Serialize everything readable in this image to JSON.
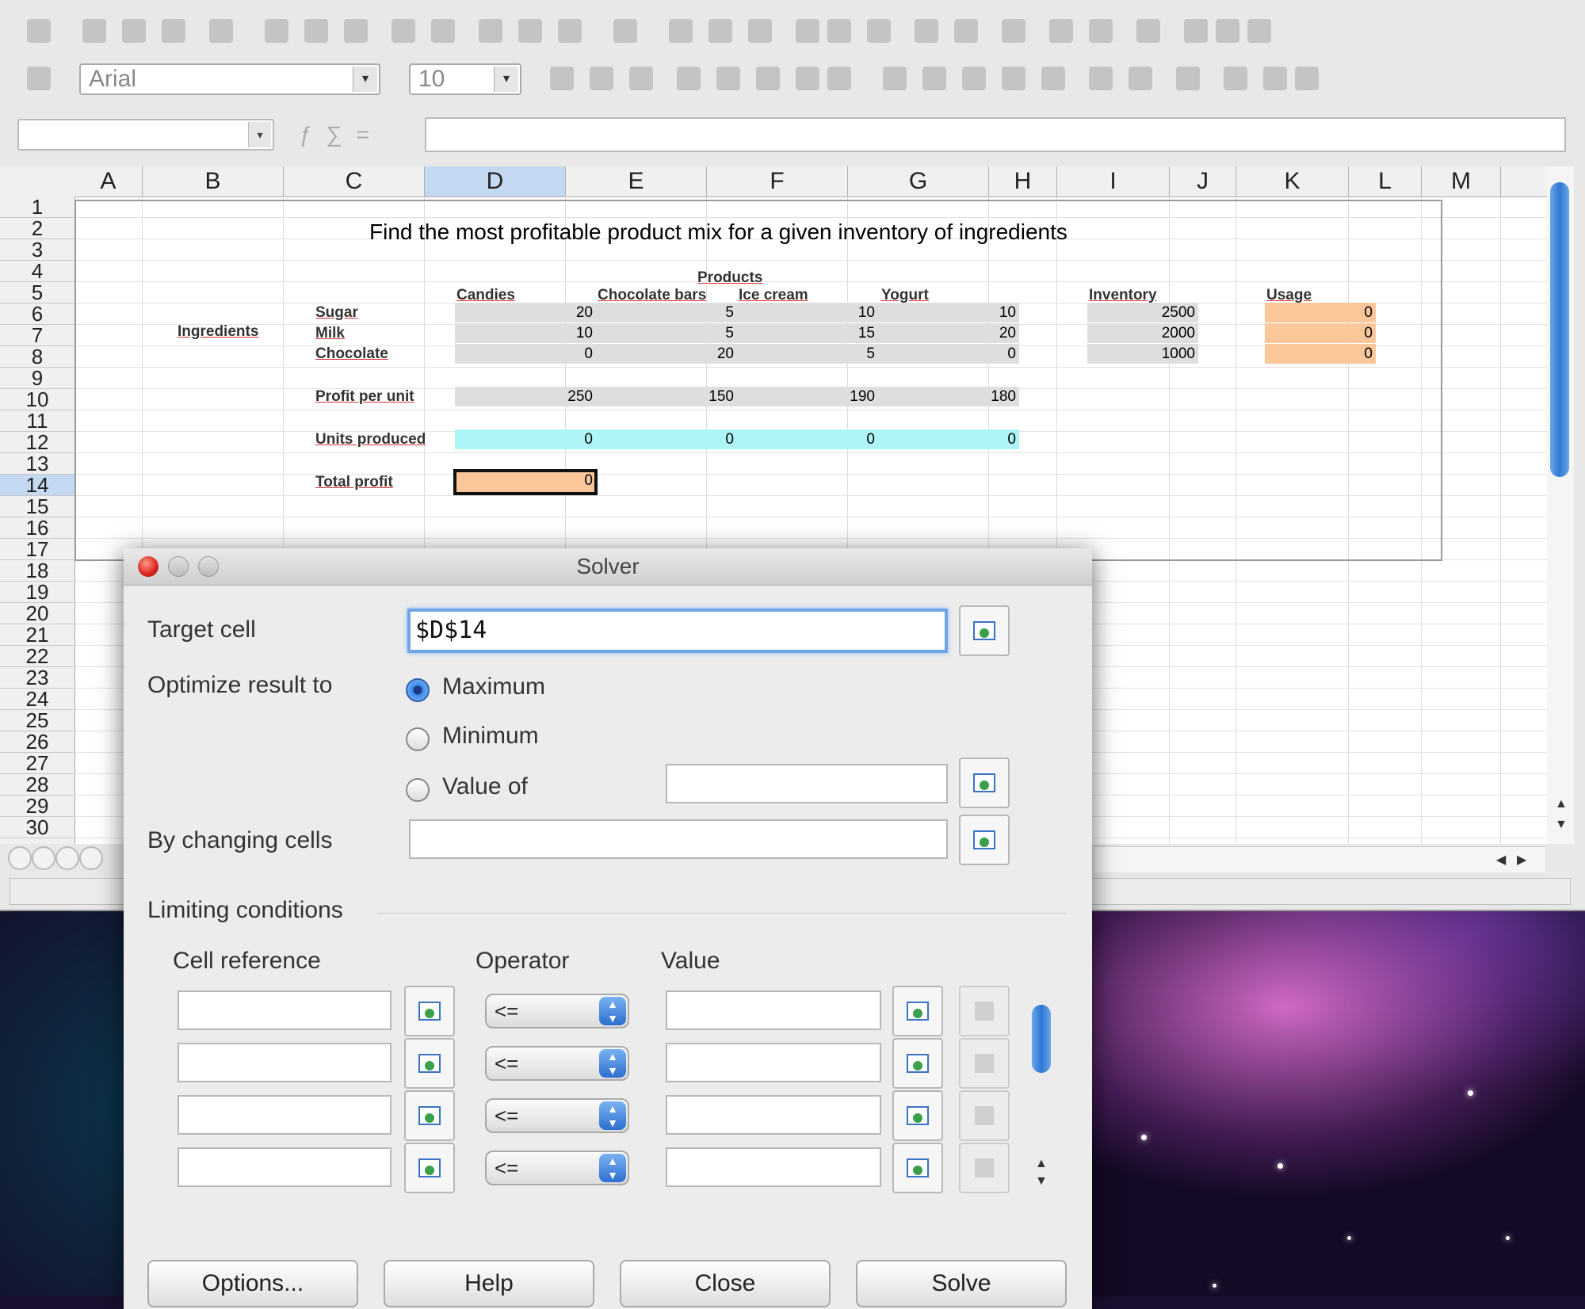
{
  "toolbar": {
    "font_name": "Arial",
    "font_size": "10"
  },
  "columns": [
    "A",
    "B",
    "C",
    "D",
    "E",
    "F",
    "G",
    "H",
    "I",
    "J",
    "K",
    "L",
    "M"
  ],
  "rows": [
    "1",
    "2",
    "3",
    "4",
    "5",
    "6",
    "7",
    "8",
    "9",
    "10",
    "11",
    "12",
    "13",
    "14",
    "15",
    "16",
    "17",
    "18",
    "19",
    "20",
    "21",
    "22",
    "23",
    "24",
    "25",
    "26",
    "27",
    "28",
    "29",
    "30"
  ],
  "sheet": {
    "heading": "Find the most profitable product mix for a given inventory of ingredients",
    "products_label": "Products",
    "products": [
      "Candies",
      "Chocolate bars",
      "Ice cream",
      "Yogurt"
    ],
    "inventory_label": "Inventory",
    "usage_label": "Usage",
    "ingredients_label": "Ingredients",
    "ingredient_rows": [
      {
        "name": "Sugar",
        "values": [
          "20",
          "5",
          "10",
          "10"
        ],
        "inventory": "2500",
        "usage": "0"
      },
      {
        "name": "Milk",
        "values": [
          "10",
          "5",
          "15",
          "20"
        ],
        "inventory": "2000",
        "usage": "0"
      },
      {
        "name": "Chocolate",
        "values": [
          "0",
          "20",
          "5",
          "0"
        ],
        "inventory": "1000",
        "usage": "0"
      }
    ],
    "profit_label": "Profit per unit",
    "profit_values": [
      "250",
      "150",
      "190",
      "180"
    ],
    "units_label": "Units produced",
    "units_values": [
      "0",
      "0",
      "0",
      "0"
    ],
    "total_label": "Total profit",
    "total_value": "0"
  },
  "dialog": {
    "title": "Solver",
    "target_label": "Target cell",
    "target_value": "$D$14",
    "optimize_label": "Optimize result to",
    "opt_max": "Maximum",
    "opt_min": "Minimum",
    "opt_value": "Value of",
    "selected_option": "Maximum",
    "changing_label": "By changing cells",
    "conditions_label": "Limiting conditions",
    "col_cellref": "Cell reference",
    "col_operator": "Operator",
    "col_value": "Value",
    "conditions": [
      {
        "operator": "<="
      },
      {
        "operator": "<="
      },
      {
        "operator": "<="
      },
      {
        "operator": "<="
      }
    ],
    "buttons": {
      "options": "Options...",
      "help": "Help",
      "close": "Close",
      "solve": "Solve"
    }
  }
}
